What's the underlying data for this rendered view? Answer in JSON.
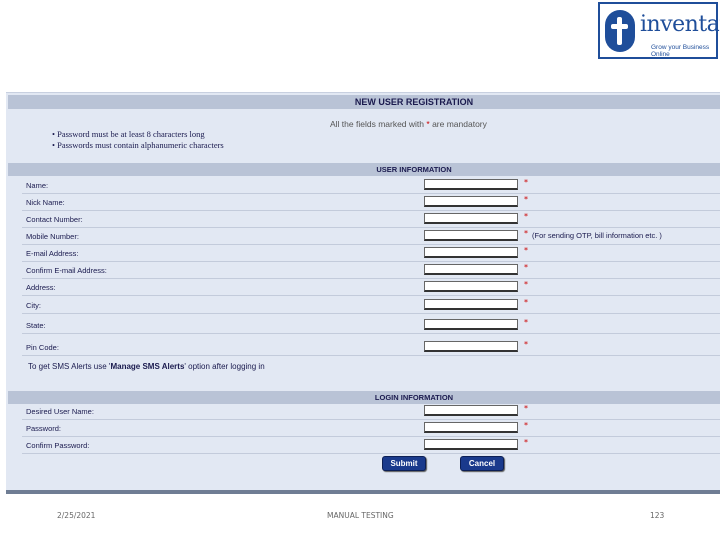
{
  "logo": {
    "name": "inventateq",
    "tagline": "Grow your Business Online",
    "brand_color": "#1f4e9a"
  },
  "form": {
    "title": "NEW USER REGISTRATION",
    "mandatory_note_before": "All the fields marked with",
    "mandatory_note_star": "*",
    "mandatory_note_after": "are mandatory",
    "password_rules": [
      "• Password must be at least 8 characters long",
      "• Passwords must contain alphanumeric characters"
    ],
    "user_info": {
      "heading": "USER INFORMATION",
      "fields": [
        {
          "label": "Name:",
          "value": "",
          "required": "*",
          "hint": ""
        },
        {
          "label": "Nick Name:",
          "value": "",
          "required": "*",
          "hint": ""
        },
        {
          "label": "Contact Number:",
          "value": "",
          "required": "*",
          "hint": ""
        },
        {
          "label": "Mobile Number:",
          "value": "",
          "required": "*",
          "hint": "(For sending OTP, bill information etc. )"
        },
        {
          "label": "E-mail Address:",
          "value": "",
          "required": "*",
          "hint": ""
        },
        {
          "label": "Confirm E-mail Address:",
          "value": "",
          "required": "*",
          "hint": ""
        },
        {
          "label": "Address:",
          "value": "",
          "required": "*",
          "hint": ""
        },
        {
          "label": "City:",
          "value": "",
          "required": "*",
          "hint": ""
        },
        {
          "label": "State:",
          "value": "",
          "required": "*",
          "hint": ""
        },
        {
          "label": "Pin Code:",
          "value": "",
          "required": "*",
          "hint": ""
        }
      ]
    },
    "sms_note": {
      "before": "To get SMS Alerts use '",
      "bold": "Manage SMS Alerts",
      "after": "' option after logging in"
    },
    "login_info": {
      "heading": "LOGIN INFORMATION",
      "fields": [
        {
          "label": "Desired User Name:",
          "value": "",
          "required": "*"
        },
        {
          "label": "Password:",
          "value": "",
          "required": "*"
        },
        {
          "label": "Confirm Password:",
          "value": "",
          "required": "*"
        }
      ]
    },
    "buttons": {
      "submit": "Submit",
      "cancel": "Cancel"
    },
    "colors": {
      "panel_bg": "#e2e8f3",
      "header_bg": "#b9c3d6",
      "button_bg": "#1a3a8c",
      "required": "#cc0000"
    }
  },
  "footer": {
    "date": "2/25/2021",
    "center": "MANUAL TESTING",
    "page": "123"
  }
}
